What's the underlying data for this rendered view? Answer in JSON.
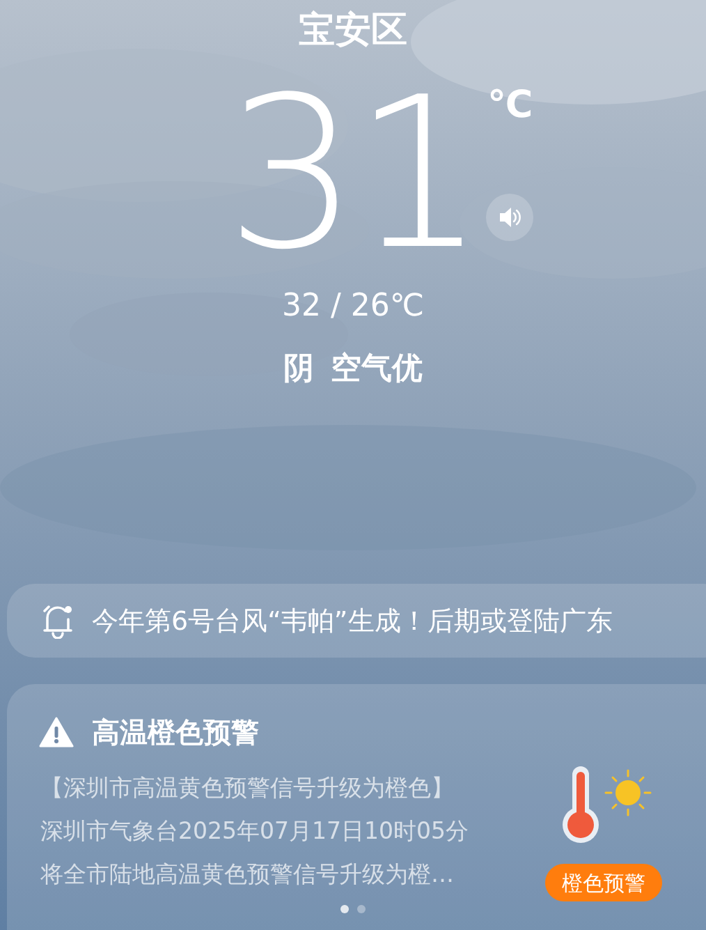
{
  "location": "宝安区",
  "temperature": "31",
  "unit": "℃",
  "range": "32 / 26℃",
  "condition": "阴",
  "air_quality": "空气优",
  "news": {
    "text": "今年第6号台风“韦帕”生成！后期或登陆广东"
  },
  "alert": {
    "title": "高温橙色预警",
    "lines": [
      "【深圳市高温黄色预警信号升级为橙色】",
      "深圳市气象台2025年07月17日10时05分",
      "将全市陆地高温黄色预警信号升级为橙…"
    ],
    "badge": "橙色预警",
    "color": "#ff7d0d"
  },
  "pager": [
    {
      "selected": true
    },
    {
      "selected": false
    }
  ]
}
